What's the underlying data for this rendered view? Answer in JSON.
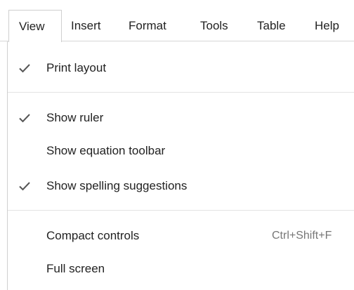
{
  "menubar": {
    "items": [
      {
        "label": "View"
      },
      {
        "label": "Insert"
      },
      {
        "label": "Format"
      },
      {
        "label": "Tools"
      },
      {
        "label": "Table"
      },
      {
        "label": "Help"
      }
    ],
    "active": "View"
  },
  "view_menu": {
    "items": [
      {
        "label": "Print layout",
        "checked": true
      },
      {
        "label": "Show ruler",
        "checked": true
      },
      {
        "label": "Show equation toolbar",
        "checked": false
      },
      {
        "label": "Show spelling suggestions",
        "checked": true
      },
      {
        "label": "Compact controls",
        "shortcut": "Ctrl+Shift+F",
        "checked": false
      },
      {
        "label": "Full screen",
        "checked": false
      }
    ]
  },
  "icons": {
    "check": "check-icon"
  },
  "colors": {
    "text": "#222222",
    "shortcut_text": "#777777",
    "check": "#555555",
    "separator": "#e3e3e3"
  }
}
